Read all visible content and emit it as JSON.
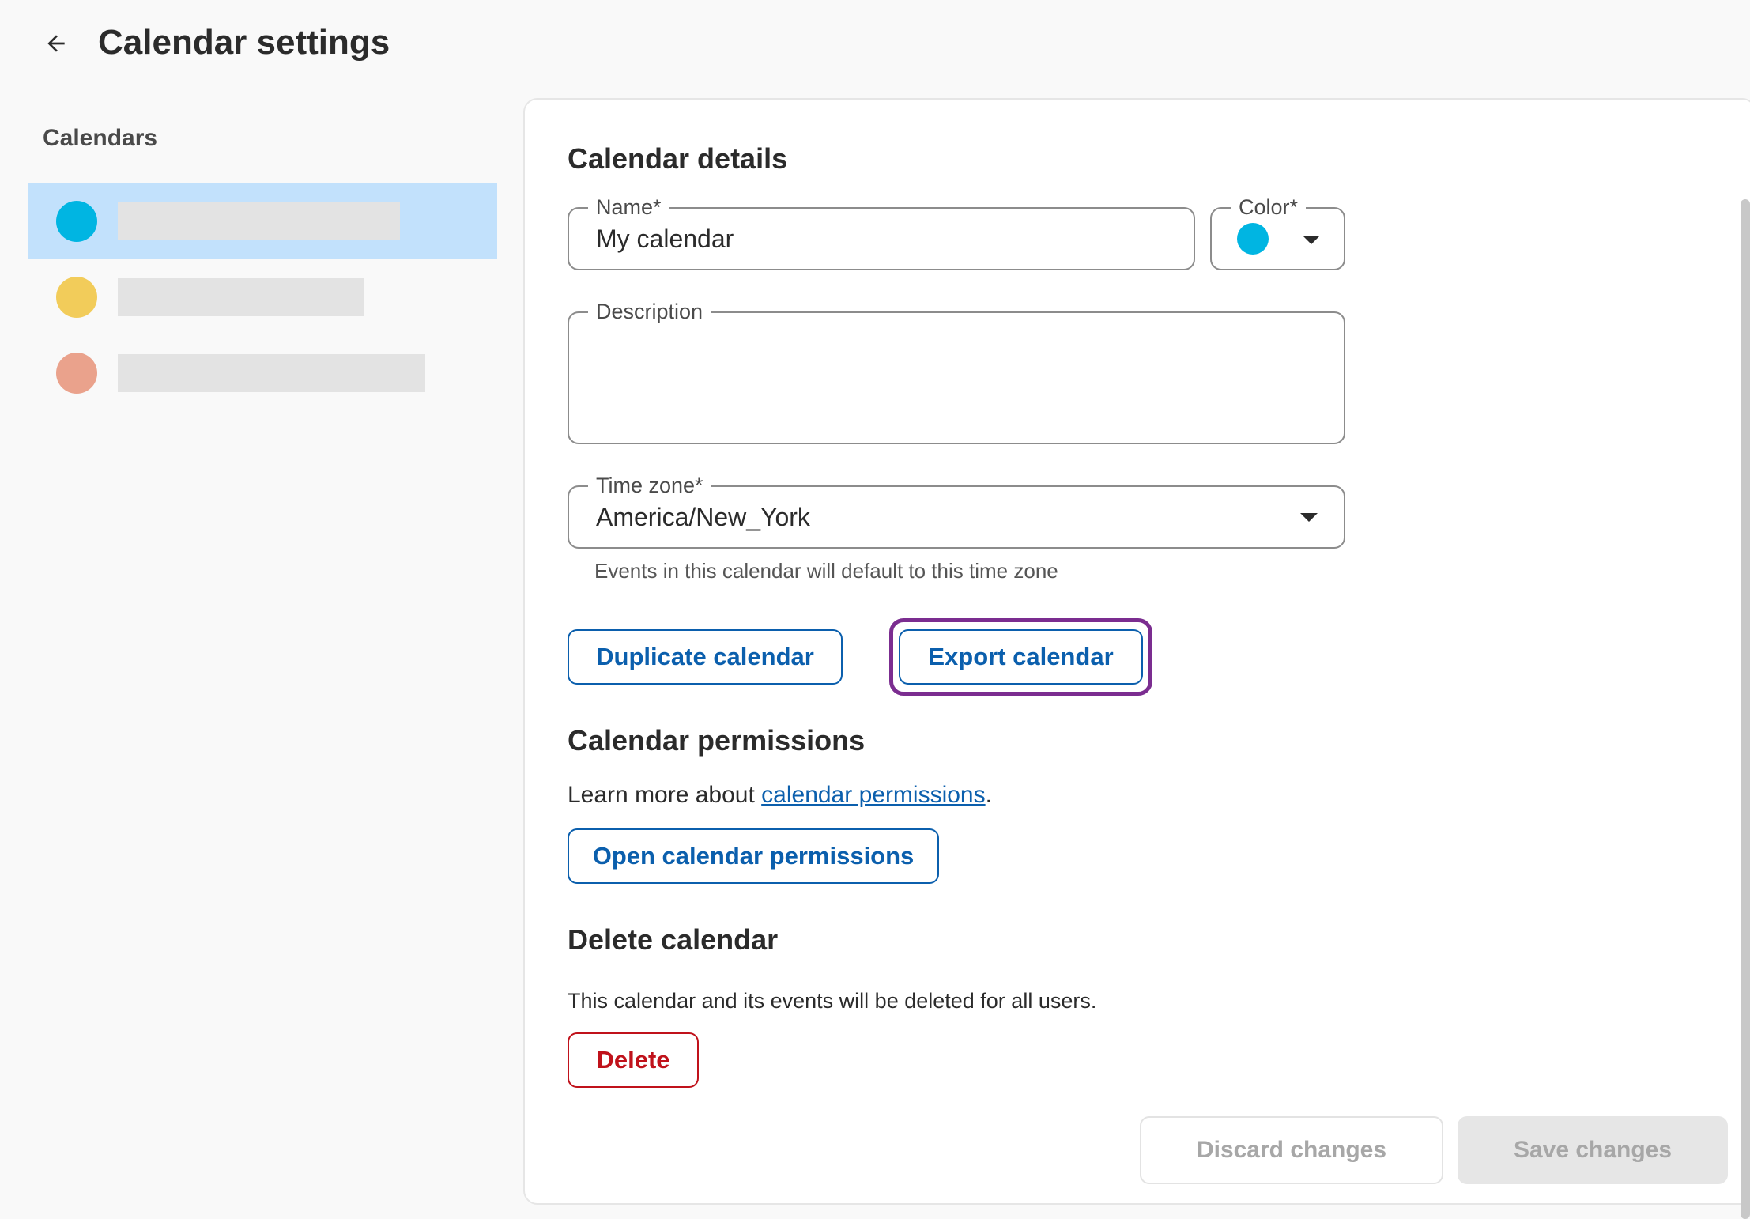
{
  "header": {
    "back_icon": "arrow-left-icon",
    "title": "Calendar settings"
  },
  "sidebar": {
    "heading": "Calendars",
    "items": [
      {
        "color": "#00b5e2",
        "selected": true
      },
      {
        "color": "#f2cc5a",
        "selected": false
      },
      {
        "color": "#eaa28c",
        "selected": false
      }
    ]
  },
  "details": {
    "title": "Calendar details",
    "name_label": "Name",
    "name_required": "*",
    "name_value": "My calendar",
    "color_label": "Color",
    "color_required": "*",
    "color_value": "#00b5e2",
    "description_label": "Description",
    "description_value": "",
    "timezone_label": "Time zone",
    "timezone_required": "*",
    "timezone_value": "America/New_York",
    "timezone_helper": "Events in this calendar will default to this time zone",
    "duplicate_label": "Duplicate calendar",
    "export_label": "Export calendar"
  },
  "permissions": {
    "title": "Calendar permissions",
    "text_prefix": "Learn more about ",
    "link_text": "calendar permissions",
    "text_suffix": ".",
    "open_label": "Open calendar permissions"
  },
  "delete": {
    "title": "Delete calendar",
    "text": "This calendar and its events will be deleted for all users.",
    "button_label": "Delete"
  },
  "footer": {
    "discard_label": "Discard changes",
    "save_label": "Save changes"
  },
  "colors": {
    "accent": "#0b5fad",
    "danger": "#c0121b",
    "focus": "#7b2d90",
    "selected_bg": "#c2e1fc"
  }
}
